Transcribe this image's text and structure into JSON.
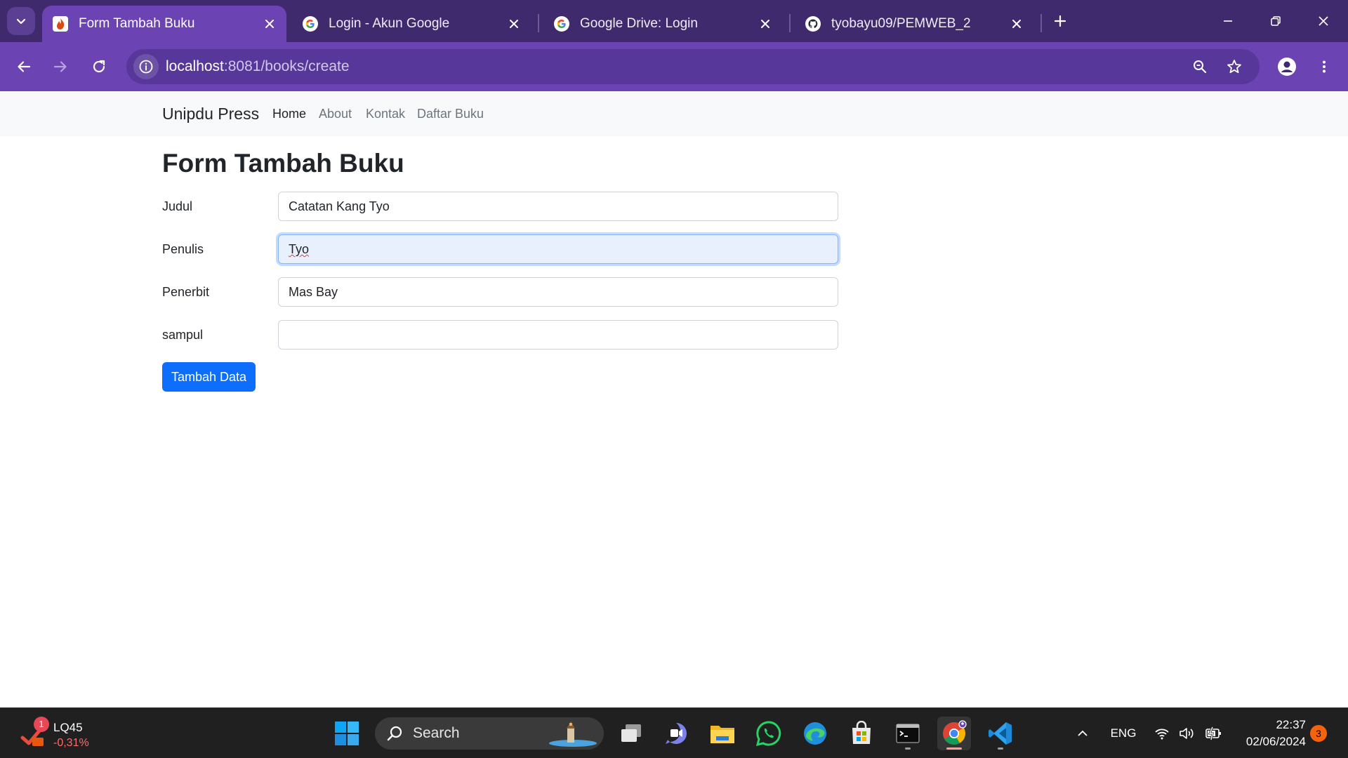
{
  "browser": {
    "tabs": [
      {
        "title": "Form Tambah Buku",
        "active": true,
        "icon": "codeigniter-flame-icon"
      },
      {
        "title": "Login - Akun Google",
        "active": false,
        "icon": "google-g-icon"
      },
      {
        "title": "Google Drive: Login",
        "active": false,
        "icon": "google-g-icon"
      },
      {
        "title": "tyobayu09/PEMWEB_2",
        "active": false,
        "icon": "github-icon"
      }
    ],
    "url_host": "localhost",
    "url_path": ":8081/books/create"
  },
  "navbar": {
    "brand": "Unipdu Press",
    "links": [
      "Home",
      "About",
      "Kontak",
      "Daftar Buku"
    ]
  },
  "page": {
    "title": "Form Tambah Buku",
    "fields": [
      {
        "label": "Judul",
        "value": "Catatan Kang Tyo"
      },
      {
        "label": "Penulis",
        "value": "Tyo"
      },
      {
        "label": "Penerbit",
        "value": "Mas Bay"
      },
      {
        "label": "sampul",
        "value": ""
      }
    ],
    "submit_label": "Tambah Data"
  },
  "taskbar": {
    "widget_name": "LQ45",
    "widget_change": "-0,31%",
    "widget_badge": "1",
    "search_label": "Search",
    "language": "ENG",
    "time": "22:37",
    "date": "02/06/2024",
    "notification_count": "3"
  },
  "colors": {
    "tabbar": "#3f2a6e",
    "toolbar": "#6b43b3",
    "primary_button": "#0d6efd",
    "taskbar": "#202020"
  }
}
